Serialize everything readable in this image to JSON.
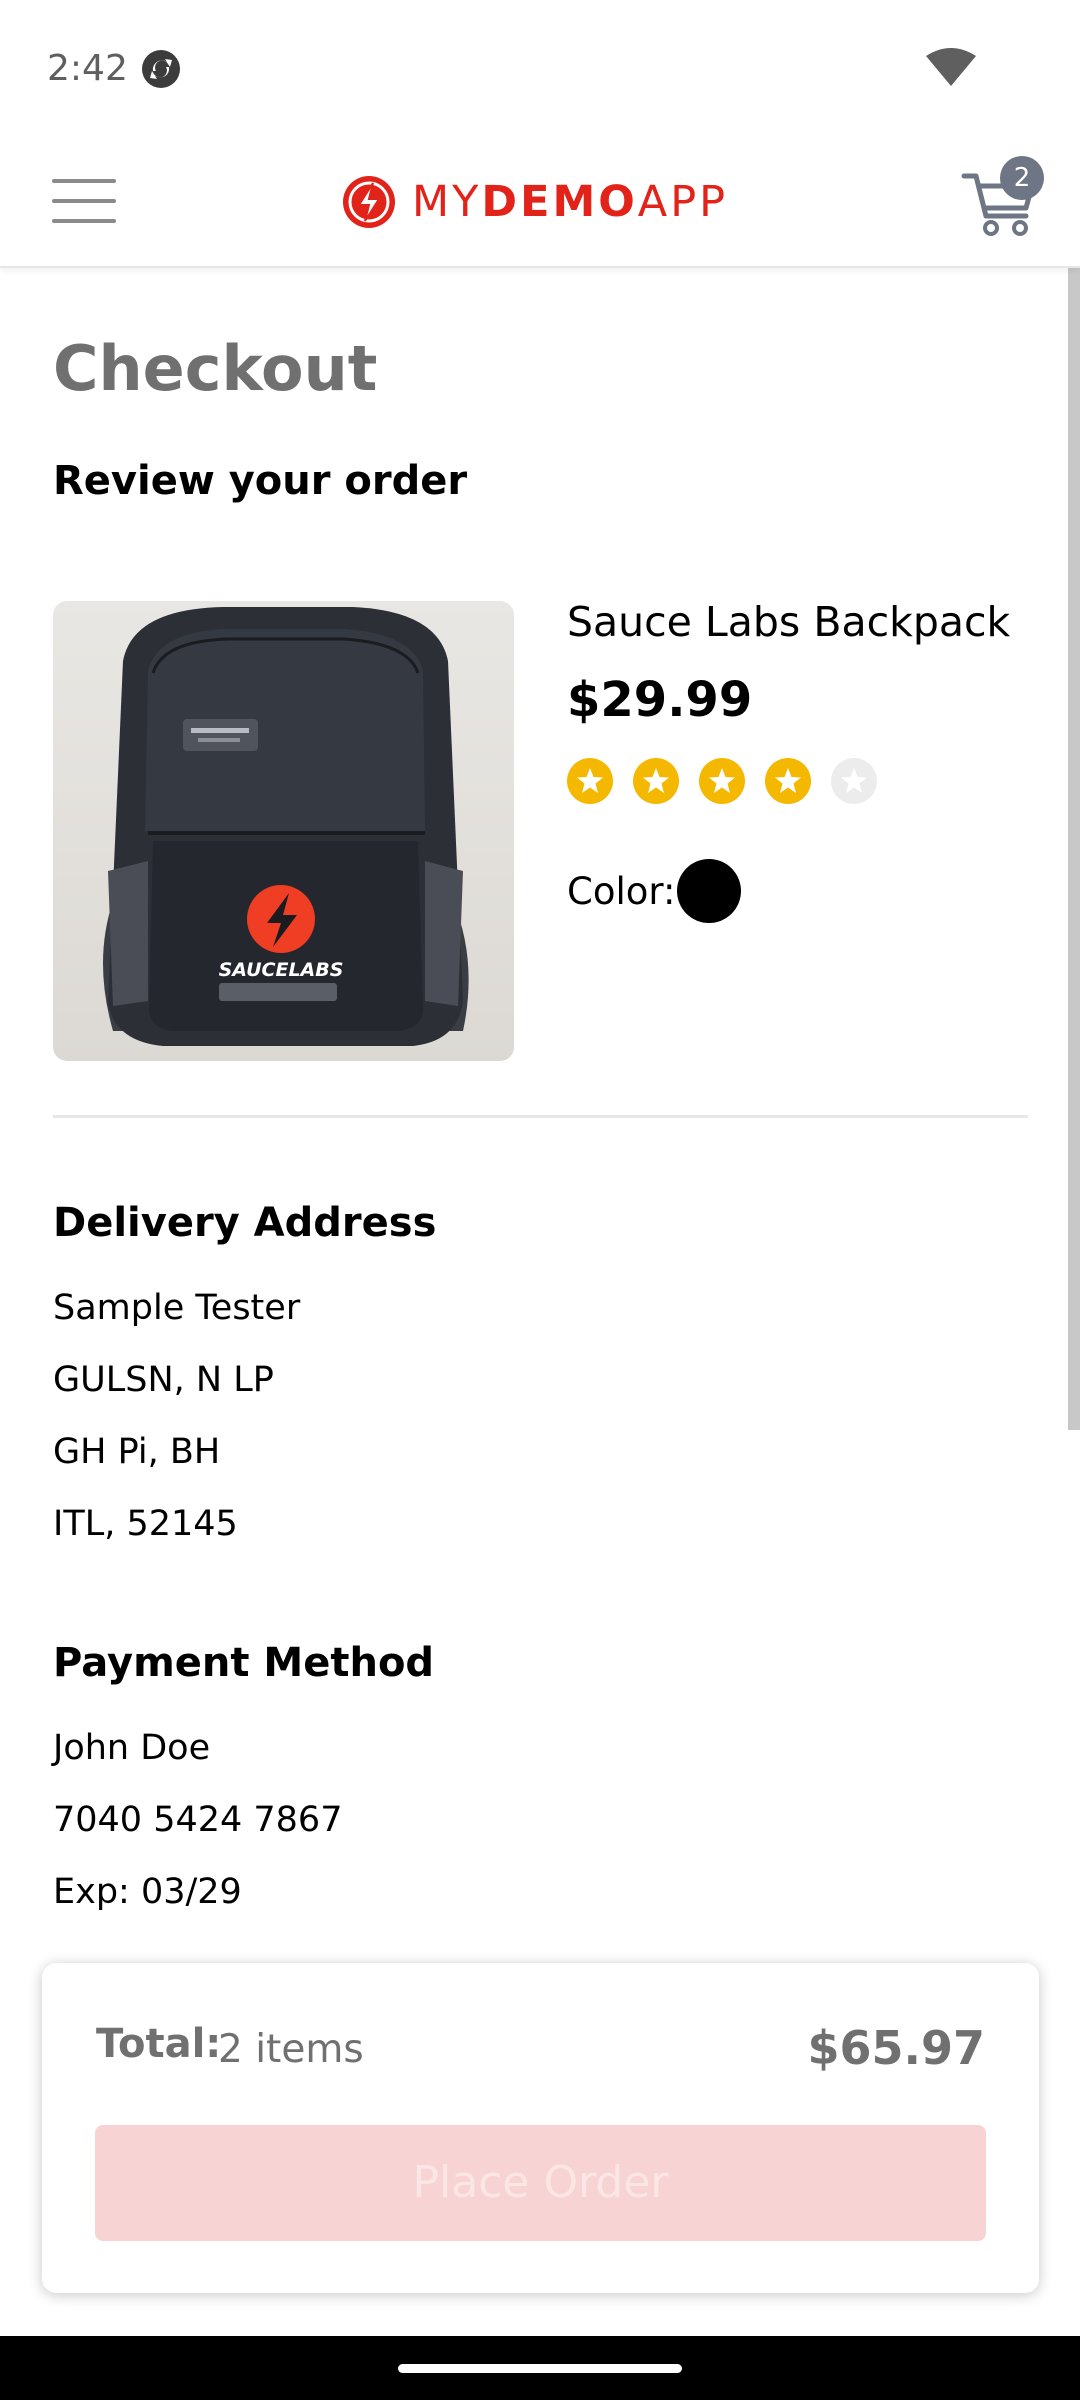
{
  "status_bar": {
    "time": "2:42"
  },
  "header": {
    "logo": {
      "part1": "MY",
      "part2": "DEMO",
      "part3": "APP"
    },
    "cart_count": "2"
  },
  "page": {
    "title": "Checkout",
    "subtitle": "Review your order"
  },
  "product": {
    "name": "Sauce Labs Backpack",
    "price": "$29.99",
    "rating": 4,
    "rating_max": 5,
    "color_label": "Color:",
    "color_value": "#000000"
  },
  "delivery": {
    "heading": "Delivery Address",
    "lines": [
      "Sample Tester",
      "GULSN, N LP",
      "GH Pi, BH",
      "ITL, 52145"
    ]
  },
  "payment": {
    "heading": "Payment Method",
    "lines": [
      "John Doe",
      "7040 5424 7867",
      "Exp: 03/29"
    ]
  },
  "summary": {
    "total_label": "Total:",
    "items": "2 items",
    "amount": "$65.97",
    "place_order_label": "Place Order"
  },
  "colors": {
    "brand": "#e2231a",
    "muted_text": "#707070",
    "star": "#f5b800",
    "button_disabled": "#f7d3d3"
  }
}
